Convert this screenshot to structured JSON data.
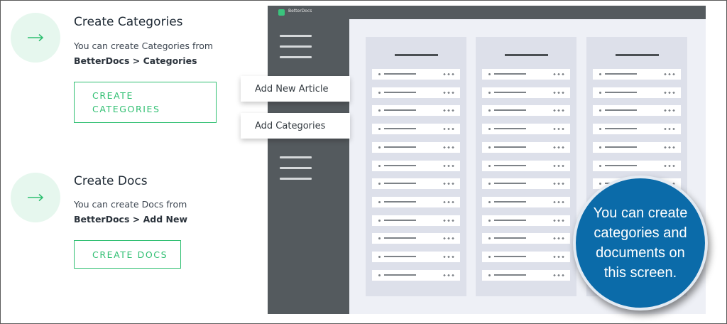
{
  "steps": [
    {
      "title": "Create Categories",
      "desc_line1": "You can create Categories from",
      "desc_path": "BetterDocs > Categories",
      "button_line1": "CREATE",
      "button_line2": "CATEGORIES",
      "icon": "arrow-right-icon"
    },
    {
      "title": "Create Docs",
      "desc_line1": "You can create Docs from",
      "desc_path": "BetterDocs > Add New",
      "button_label": "CREATE DOCS",
      "icon": "arrow-right-icon"
    }
  ],
  "app": {
    "title": "BetterDocs",
    "popups": [
      "Add New Article",
      "Add Categories"
    ]
  },
  "callout": {
    "text": "You can create categories and documents on this screen."
  },
  "colors": {
    "accent": "#2fbf71",
    "sidebar": "#545a5e",
    "callout": "#0b6ba9"
  }
}
